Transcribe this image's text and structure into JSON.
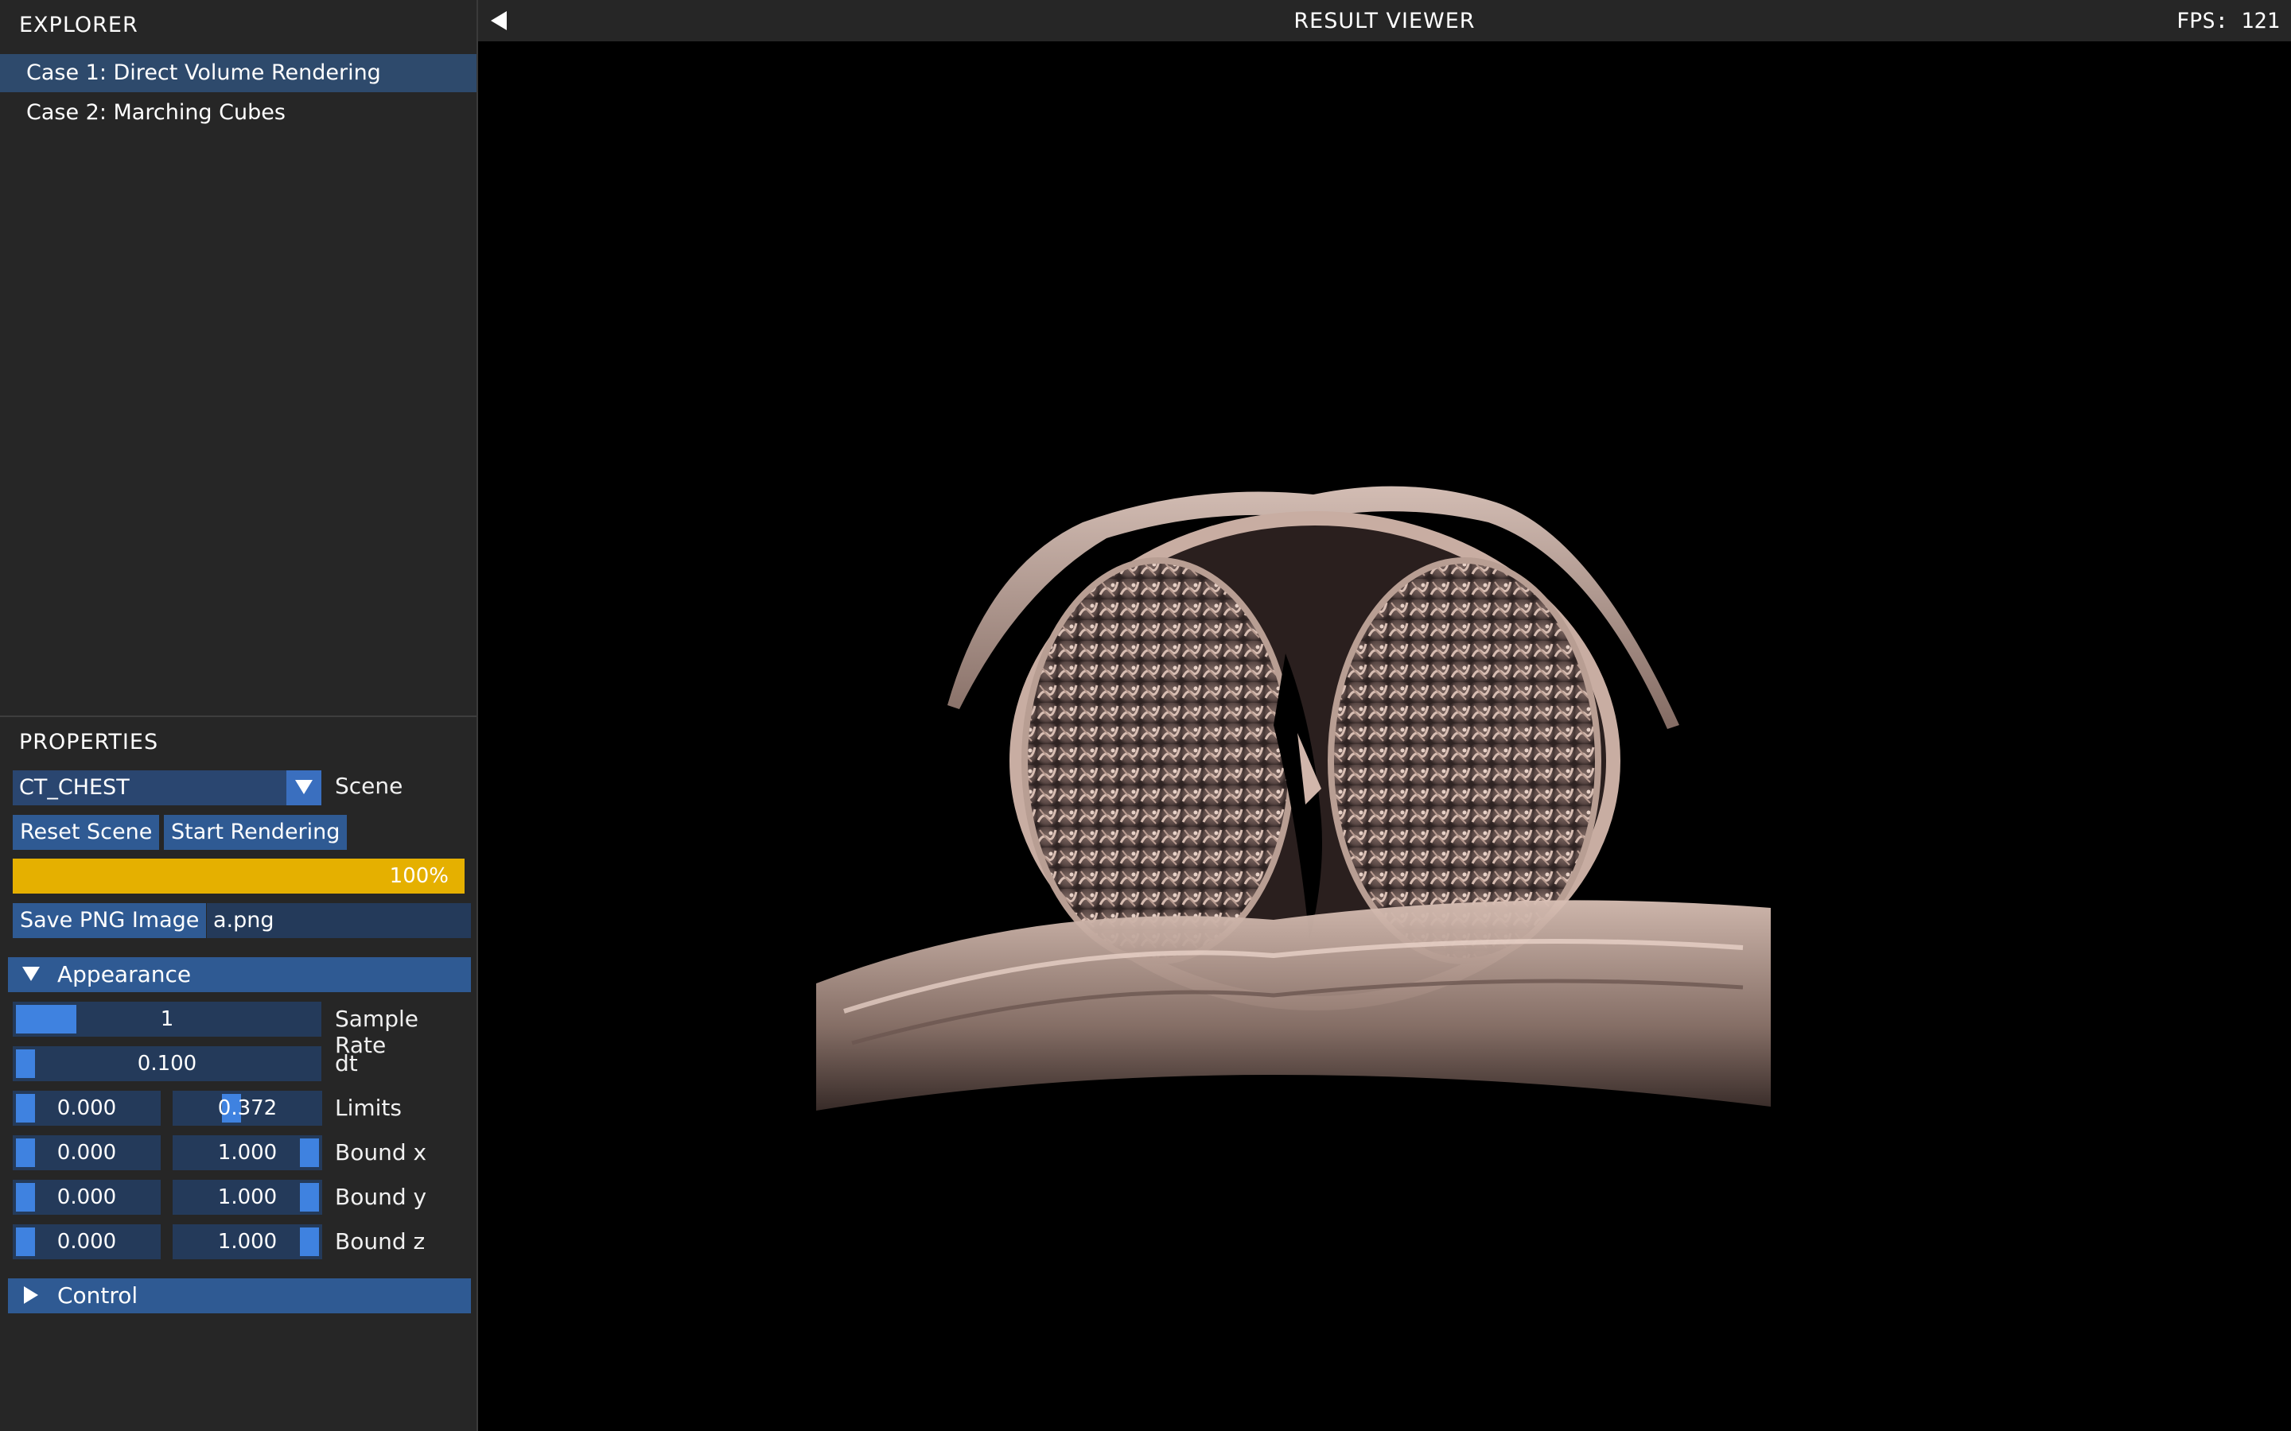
{
  "explorer": {
    "title": "EXPLORER",
    "items": [
      {
        "label": "Case 1: Direct Volume Rendering",
        "selected": true
      },
      {
        "label": "Case 2: Marching Cubes",
        "selected": false
      }
    ]
  },
  "properties": {
    "title": "PROPERTIES",
    "scene_value": "CT_CHEST",
    "scene_label": "Scene",
    "reset_label": "Reset Scene",
    "start_label": "Start Rendering",
    "progress_text": "100%",
    "progress_value": 1.0,
    "save_label": "Save PNG Image",
    "filename": "a.png"
  },
  "appearance": {
    "label": "Appearance",
    "sample_rate": {
      "value": "1",
      "label": "Sample Rate",
      "fraction": 0.13
    },
    "dt": {
      "value": "0.100",
      "label": "dt",
      "fraction": 0.0
    },
    "limits": {
      "min": "0.000",
      "max": "0.372",
      "label": "Limits",
      "max_fraction": 0.372
    },
    "bound_x": {
      "min": "0.000",
      "max": "1.000",
      "label": "Bound x"
    },
    "bound_y": {
      "min": "0.000",
      "max": "1.000",
      "label": "Bound y"
    },
    "bound_z": {
      "min": "0.000",
      "max": "1.000",
      "label": "Bound z"
    }
  },
  "control": {
    "label": "Control"
  },
  "viewer": {
    "title": "RESULT VIEWER",
    "fps_text": "FPS: 121",
    "render_color": "#c9aa9e"
  },
  "colors": {
    "panel_bg": "#262626",
    "selected_item": "#2e4a6c",
    "button": "#2f5a93",
    "slider_grab": "#3f82e0",
    "progress": "#e5b000"
  }
}
